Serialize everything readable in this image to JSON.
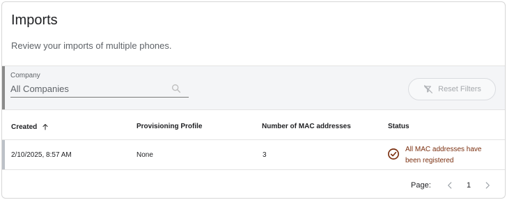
{
  "header": {
    "title": "Imports",
    "subtitle": "Review your imports of multiple phones."
  },
  "filters": {
    "company_label": "Company",
    "company_value": "All Companies",
    "reset_label": "Reset Filters"
  },
  "table": {
    "columns": [
      "Created",
      "Provisioning Profile",
      "Number of MAC addresses",
      "Status"
    ],
    "sort_icon": "arrow-up-icon",
    "rows": [
      {
        "created": "2/10/2025, 8:57 AM",
        "profile": "None",
        "mac_count": "3",
        "status": "All MAC addresses have been registered"
      }
    ]
  },
  "pagination": {
    "label": "Page:",
    "current": "1"
  },
  "colors": {
    "status_text": "#7a2e0e",
    "filter_bg": "#f4f5f7",
    "disabled": "#a6a9ad"
  }
}
